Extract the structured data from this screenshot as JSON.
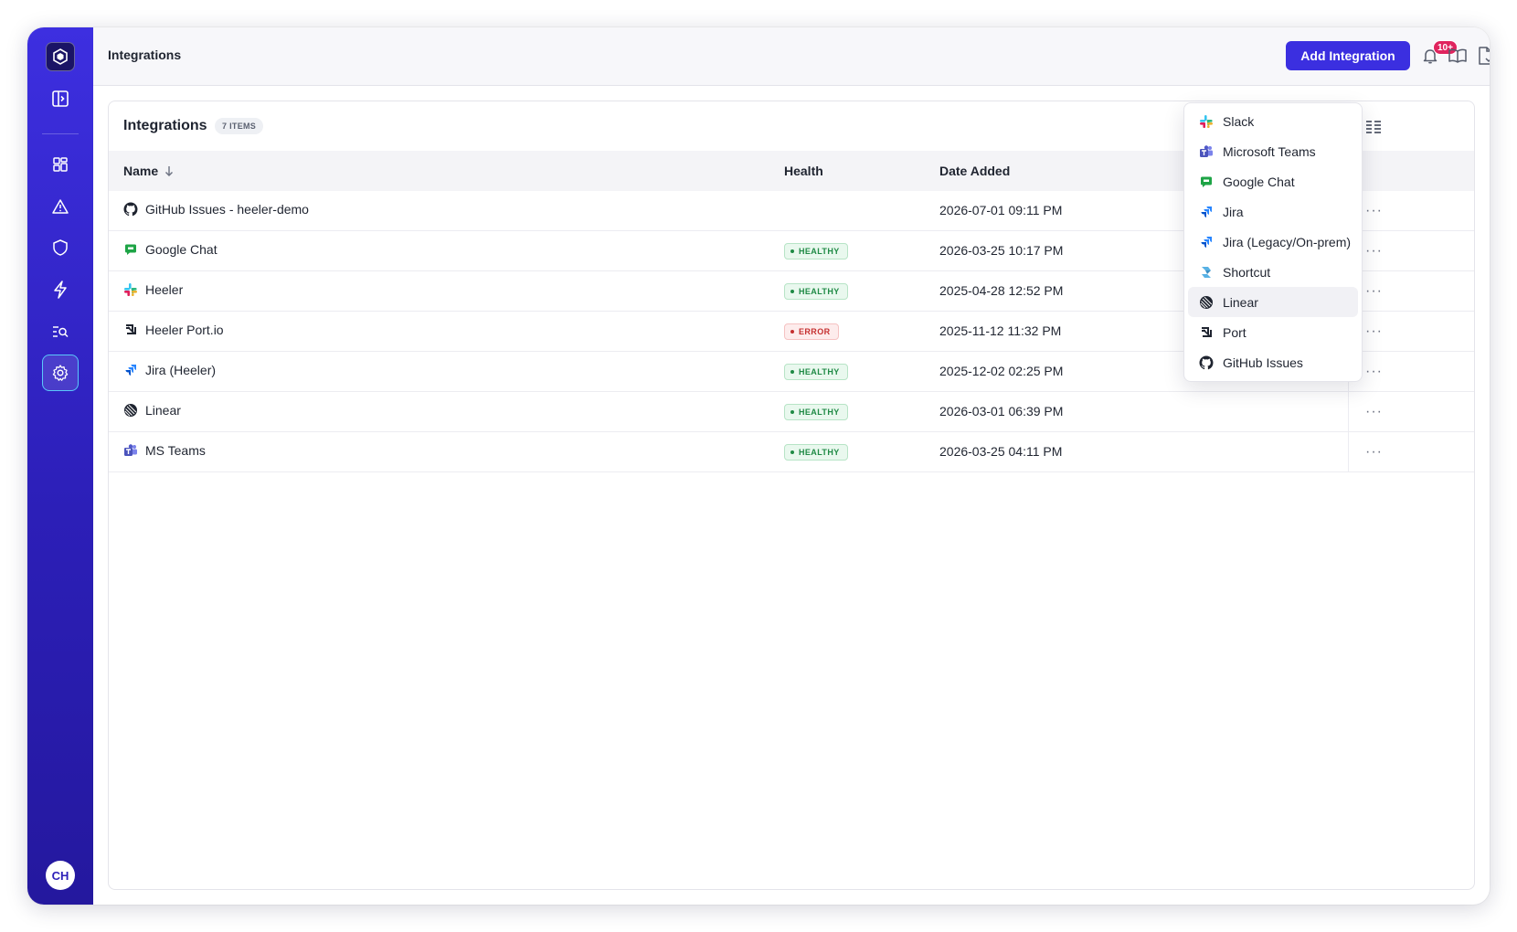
{
  "topbar": {
    "title": "Integrations",
    "add_button": "Add Integration",
    "notification_badge": "10+"
  },
  "sidebar": {
    "nav_icons": [
      "panel-toggle-icon",
      "dashboard-icon",
      "warning-icon",
      "shield-icon",
      "bolt-icon",
      "search-list-icon",
      "gear-icon"
    ],
    "active": "settings",
    "avatar_initials": "CH"
  },
  "card": {
    "title": "Integrations",
    "count_label": "7 ITEMS",
    "columns": {
      "name": "Name",
      "health": "Health",
      "date_added": "Date Added"
    },
    "rows": [
      {
        "icon": "github-icon",
        "name": "GitHub Issues - heeler-demo",
        "health": "",
        "health_status": "none",
        "date": "2026-07-01 09:11 PM"
      },
      {
        "icon": "google-chat-icon",
        "name": "Google Chat",
        "health": "HEALTHY",
        "health_status": "healthy",
        "date": "2026-03-25 10:17 PM"
      },
      {
        "icon": "slack-icon",
        "name": "Heeler",
        "health": "HEALTHY",
        "health_status": "healthy",
        "date": "2025-04-28 12:52 PM"
      },
      {
        "icon": "port-icon",
        "name": "Heeler Port.io",
        "health": "ERROR",
        "health_status": "error",
        "date": "2025-11-12 11:32 PM"
      },
      {
        "icon": "jira-icon",
        "name": "Jira (Heeler)",
        "health": "HEALTHY",
        "health_status": "healthy",
        "date": "2025-12-02 02:25 PM"
      },
      {
        "icon": "linear-icon",
        "name": "Linear",
        "health": "HEALTHY",
        "health_status": "healthy",
        "date": "2026-03-01 06:39 PM"
      },
      {
        "icon": "ms-teams-icon",
        "name": "MS Teams",
        "health": "HEALTHY",
        "health_status": "healthy",
        "date": "2026-03-25 04:11 PM"
      }
    ],
    "row_action_label": "···"
  },
  "dropdown": {
    "items": [
      {
        "icon": "slack-icon",
        "label": "Slack"
      },
      {
        "icon": "ms-teams-icon",
        "label": "Microsoft Teams"
      },
      {
        "icon": "google-chat-icon",
        "label": "Google Chat"
      },
      {
        "icon": "jira-icon",
        "label": "Jira"
      },
      {
        "icon": "jira-icon",
        "label": "Jira (Legacy/On-prem)"
      },
      {
        "icon": "shortcut-icon",
        "label": "Shortcut"
      },
      {
        "icon": "linear-icon",
        "label": "Linear"
      },
      {
        "icon": "port-icon",
        "label": "Port"
      },
      {
        "icon": "github-icon",
        "label": "GitHub Issues"
      }
    ],
    "hovered_item": "Linear"
  },
  "colors": {
    "accent": "#3b2fe0",
    "sidebar_top": "#3d2fe0",
    "sidebar_bottom": "#24189e",
    "healthy": "#1f8a45",
    "error": "#c53030",
    "notification": "#e0245e"
  }
}
